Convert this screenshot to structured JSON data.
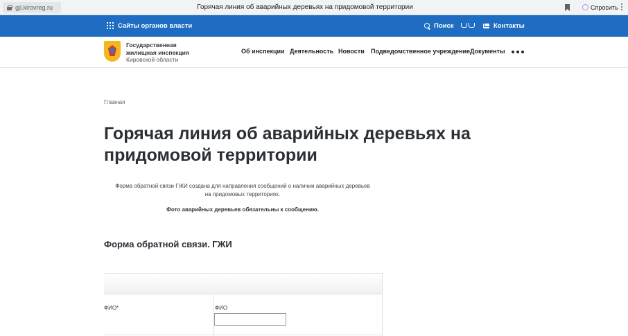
{
  "browser": {
    "url": "gji.kirovreg.ru",
    "tab_title": "Горячая линия об аварийных деревьях на придомовой территории",
    "ask_label": "Спросить"
  },
  "topbar": {
    "portal_label": "Сайты органов власти",
    "search_label": "Поиск",
    "contacts_label": "Контакты",
    "bg_color": "#1f6dc2"
  },
  "header": {
    "org_line1": "Государственная",
    "org_line2": "жилищная инспекция",
    "org_line3": "Кировской области",
    "nav": [
      {
        "label": "Об инспекции"
      },
      {
        "label": "Деятельность"
      },
      {
        "label": "Новости"
      },
      {
        "label": "Подведомственное учреждение"
      },
      {
        "label": "Документы"
      }
    ]
  },
  "main": {
    "breadcrumb": "Главная",
    "title_line1": "Горячая линия об аварийных деревьях на",
    "title_line2": "придомовой территории",
    "intro_line1": "Форма обратной связи ГЖИ создана для направления сообщений о наличии аварийных деревьев",
    "intro_line2": "на придомовых территориях.",
    "intro_bold": "Фото аварийных деревьев обязательны к сообщению.",
    "form_title": "Форма обратной связи. ГЖИ"
  },
  "form": {
    "fio_label": "ФИО*",
    "fio_caption": "ФИО",
    "fio_value": ""
  }
}
